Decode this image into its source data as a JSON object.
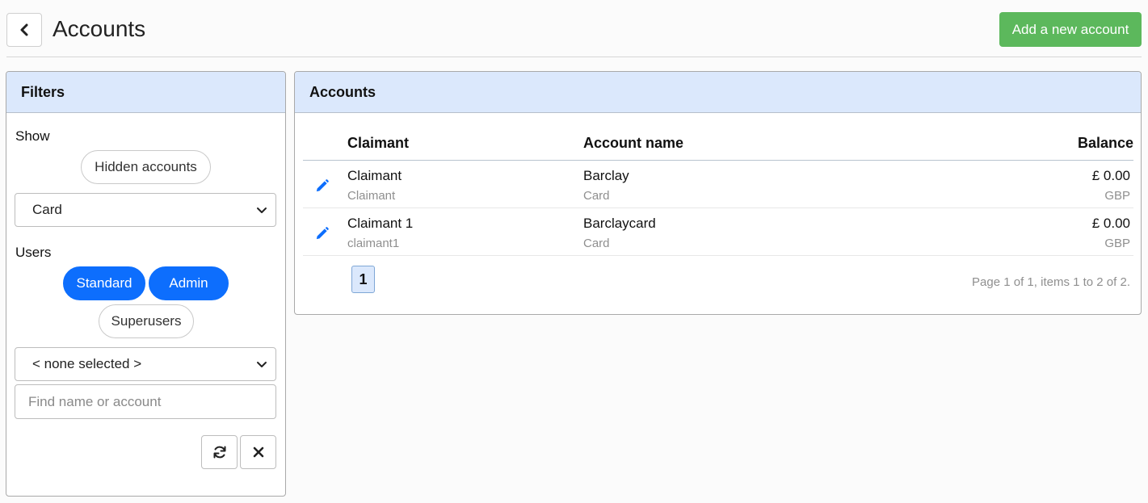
{
  "header": {
    "title": "Accounts",
    "add_button": "Add a new account",
    "back_icon": "chevron-left-icon",
    "add_button_color": "#5cb85c"
  },
  "filters": {
    "title": "Filters",
    "show_label": "Show",
    "hidden_accounts": "Hidden accounts",
    "type_select": "Card",
    "users_label": "Users",
    "user_pills": [
      {
        "label": "Standard",
        "active": true
      },
      {
        "label": "Admin",
        "active": true
      },
      {
        "label": "Superusers",
        "active": false
      }
    ],
    "user_select": "< none selected >",
    "search_placeholder": "Find name or account",
    "refresh_icon": "refresh-icon",
    "clear_icon": "close-icon",
    "active_color": "#0d6efd"
  },
  "accounts": {
    "title": "Accounts",
    "columns": [
      "Claimant",
      "Account name",
      "Balance"
    ],
    "rows": [
      {
        "claimant": "Claimant",
        "claimant_sub": "Claimant",
        "account": "Barclay",
        "account_sub": "Card",
        "balance": "£ 0.00",
        "currency": "GBP"
      },
      {
        "claimant": "Claimant 1",
        "claimant_sub": "claimant1",
        "account": "Barclaycard",
        "account_sub": "Card",
        "balance": "£ 0.00",
        "currency": "GBP"
      }
    ],
    "page": "1",
    "page_info": "Page 1 of 1, items 1 to 2 of 2.",
    "panel_header_color": "#dbe8fc"
  }
}
